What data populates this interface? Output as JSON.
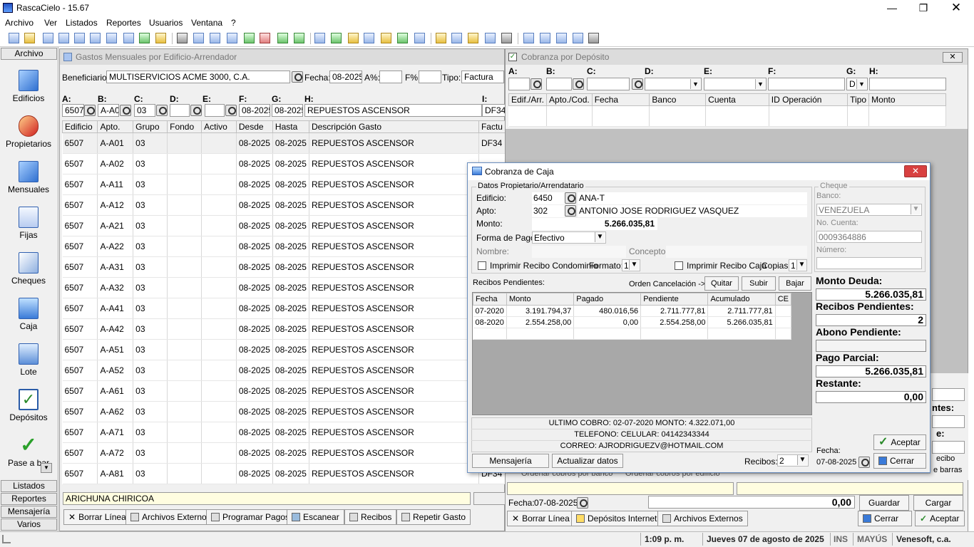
{
  "app": {
    "title": "RascaCielo - 15.67"
  },
  "menu": [
    "Archivo",
    "Ver",
    "Listados",
    "Reportes",
    "Usuarios",
    "Ventana",
    "?"
  ],
  "sidebar": {
    "head": "Archivo",
    "items": [
      {
        "label": "Edificios",
        "icon": "building-icon"
      },
      {
        "label": "Propietarios",
        "icon": "people-icon"
      },
      {
        "label": "Mensuales",
        "icon": "monthly-icon"
      },
      {
        "label": "Fijas",
        "icon": "document-icon"
      },
      {
        "label": "Cheques",
        "icon": "check-edit-icon"
      },
      {
        "label": "Caja",
        "icon": "monitor-icon"
      },
      {
        "label": "Lote",
        "icon": "windows-icon"
      },
      {
        "label": "Depósitos",
        "icon": "checkbox-icon"
      },
      {
        "label": "Pase a bar",
        "icon": "checkmark-icon"
      }
    ],
    "footer": [
      "Listados",
      "Reportes",
      "Mensajería",
      "Varios"
    ]
  },
  "gastos": {
    "title": "Gastos Mensuales por Edificio-Arrendador",
    "beneficiario_label": "Beneficiario:",
    "beneficiario": "MULTISERVICIOS ACME 3000, C.A.",
    "fecha_label": "Fecha:",
    "fecha": "08-2025",
    "a_pct_label": "A%:",
    "f_pct_label": "F%:",
    "tipo_label": "Tipo:",
    "tipo": "Factura",
    "filter_labels": [
      "A:",
      "B:",
      "C:",
      "D:",
      "E:",
      "F:",
      "G:",
      "H:",
      "I:"
    ],
    "filter_values": {
      "a": "6507",
      "b": "A-A0",
      "c": "03",
      "d": "",
      "e": "",
      "f": "08-2025",
      "g": "08-2025",
      "h": "REPUESTOS ASCENSOR",
      "i": "DF34"
    },
    "columns": [
      "Edificio",
      "Apto.",
      "Grupo",
      "Fondo",
      "Activo",
      "Desde",
      "Hasta",
      "Descripción Gasto",
      "Factu"
    ],
    "rows": [
      [
        "6507",
        "A-A01",
        "03",
        "",
        "",
        "08-2025",
        "08-2025",
        "REPUESTOS ASCENSOR",
        "DF34"
      ],
      [
        "6507",
        "A-A02",
        "03",
        "",
        "",
        "08-2025",
        "08-2025",
        "REPUESTOS ASCENSOR",
        ""
      ],
      [
        "6507",
        "A-A11",
        "03",
        "",
        "",
        "08-2025",
        "08-2025",
        "REPUESTOS ASCENSOR",
        ""
      ],
      [
        "6507",
        "A-A12",
        "03",
        "",
        "",
        "08-2025",
        "08-2025",
        "REPUESTOS ASCENSOR",
        ""
      ],
      [
        "6507",
        "A-A21",
        "03",
        "",
        "",
        "08-2025",
        "08-2025",
        "REPUESTOS ASCENSOR",
        ""
      ],
      [
        "6507",
        "A-A22",
        "03",
        "",
        "",
        "08-2025",
        "08-2025",
        "REPUESTOS ASCENSOR",
        ""
      ],
      [
        "6507",
        "A-A31",
        "03",
        "",
        "",
        "08-2025",
        "08-2025",
        "REPUESTOS ASCENSOR",
        ""
      ],
      [
        "6507",
        "A-A32",
        "03",
        "",
        "",
        "08-2025",
        "08-2025",
        "REPUESTOS ASCENSOR",
        ""
      ],
      [
        "6507",
        "A-A41",
        "03",
        "",
        "",
        "08-2025",
        "08-2025",
        "REPUESTOS ASCENSOR",
        ""
      ],
      [
        "6507",
        "A-A42",
        "03",
        "",
        "",
        "08-2025",
        "08-2025",
        "REPUESTOS ASCENSOR",
        ""
      ],
      [
        "6507",
        "A-A51",
        "03",
        "",
        "",
        "08-2025",
        "08-2025",
        "REPUESTOS ASCENSOR",
        ""
      ],
      [
        "6507",
        "A-A52",
        "03",
        "",
        "",
        "08-2025",
        "08-2025",
        "REPUESTOS ASCENSOR",
        ""
      ],
      [
        "6507",
        "A-A61",
        "03",
        "",
        "",
        "08-2025",
        "08-2025",
        "REPUESTOS ASCENSOR",
        ""
      ],
      [
        "6507",
        "A-A62",
        "03",
        "",
        "",
        "08-2025",
        "08-2025",
        "REPUESTOS ASCENSOR",
        ""
      ],
      [
        "6507",
        "A-A71",
        "03",
        "",
        "",
        "08-2025",
        "08-2025",
        "REPUESTOS ASCENSOR",
        ""
      ],
      [
        "6507",
        "A-A72",
        "03",
        "",
        "",
        "08-2025",
        "08-2025",
        "REPUESTOS ASCENSOR",
        ""
      ],
      [
        "6507",
        "A-A81",
        "03",
        "",
        "",
        "08-2025",
        "08-2025",
        "REPUESTOS ASCENSOR",
        "DF34"
      ]
    ],
    "footer_text": "ARICHUNA CHIRICOA",
    "buttons": [
      "Borrar Línea",
      "Archivos Externos",
      "Programar Pagos",
      "Escanear",
      "Recibos",
      "Repetir Gasto"
    ]
  },
  "deposito": {
    "title": "Cobranza por Depósito",
    "filter_labels": [
      "A:",
      "B:",
      "C:",
      "D:",
      "E:",
      "F:",
      "G:",
      "H:"
    ],
    "g_value": "D",
    "columns": [
      "Edif./Arr.",
      "Apto./Cod.",
      "Fecha",
      "Banco",
      "Cuenta",
      "ID Operación",
      "Tipo",
      "Monto"
    ],
    "bottom_partial_1": "Ordenar cobros por banco",
    "bottom_partial_2": "Ordenar cobros por edificio",
    "right_partial_1": "ntes:",
    "right_partial_2": "e:",
    "right_partial_3": "ecibo",
    "right_partial_4": "e barras",
    "fecha_label": "Fecha:",
    "fecha": "07-08-2025",
    "total": "0,00",
    "guardar": "Guardar",
    "cargar": "Cargar",
    "cerrar": "Cerrar",
    "aceptar": "Aceptar",
    "buttons": [
      "Borrar Línea",
      "Depósitos Internet",
      "Archivos Externos"
    ]
  },
  "caja": {
    "title": "Cobranza de Caja",
    "section_title": "Datos Propietario/Arrendatario",
    "edificio_label": "Edificio:",
    "edificio": "6450",
    "edificio_name": "ANA-T",
    "apto_label": "Apto:",
    "apto": "302",
    "apto_name": "ANTONIO JOSE RODRIGUEZ VASQUEZ",
    "monto_label": "Monto:",
    "monto": "5.266.035,81",
    "forma_label": "Forma de Pago:",
    "forma": "Efectivo",
    "nombre_label": "Nombre:",
    "concepto_label": "Concepto:",
    "imp_condominio": "Imprimir Recibo Condominio",
    "formato_label": "Formato:",
    "formato": "1",
    "imp_caja": "Imprimir Recibo Caja",
    "copias_label": "Copias:",
    "copias": "1",
    "cheque": {
      "title": "Cheque",
      "banco_label": "Banco:",
      "banco": "VENEZUELA",
      "cuenta_label": "No. Cuenta:",
      "cuenta": "0009364886",
      "numero_label": "Número:"
    },
    "recibos_label": "Recibos Pendientes:",
    "orden_label": "Orden Cancelación ->",
    "quitar": "Quitar",
    "subir": "Subir",
    "bajar": "Bajar",
    "columns": [
      "Fecha",
      "Monto",
      "Pagado",
      "Pendiente",
      "Acumulado",
      "CE"
    ],
    "rows": [
      [
        "07-2020",
        "3.191.794,37",
        "480.016,56",
        "2.711.777,81",
        "2.711.777,81",
        ""
      ],
      [
        "08-2020",
        "2.554.258,00",
        "0,00",
        "2.554.258,00",
        "5.266.035,81",
        ""
      ]
    ],
    "monto_deuda_label": "Monto Deuda:",
    "monto_deuda": "5.266.035,81",
    "recibos_pend_label": "Recibos Pendientes:",
    "recibos_pend": "2",
    "abono_label": "Abono Pendiente:",
    "abono": "",
    "pago_parcial_label": "Pago Parcial:",
    "pago_parcial": "5.266.035,81",
    "restante_label": "Restante:",
    "restante": "0,00",
    "ultimo_cobro": "ULTIMO COBRO: 02-07-2020   MONTO: 4.322.071,00",
    "telefono": "TELEFONO:   CELULAR: 04142343344",
    "correo": "CORREO: AJRODRIGUEZV@HOTMAIL.COM",
    "mensajeria": "Mensajería",
    "actualizar": "Actualizar datos",
    "recibos_count_label": "Recibos:",
    "recibos_count": "2",
    "fecha_label": "Fecha:",
    "fecha": "07-08-2025",
    "aceptar": "Aceptar",
    "cerrar": "Cerrar"
  },
  "status": {
    "time": "1:09 p. m.",
    "date": "Jueves 07 de agosto de 2025",
    "ins": "INS",
    "mayus": "MAYÚS",
    "company": "Venesoft, c.a."
  }
}
